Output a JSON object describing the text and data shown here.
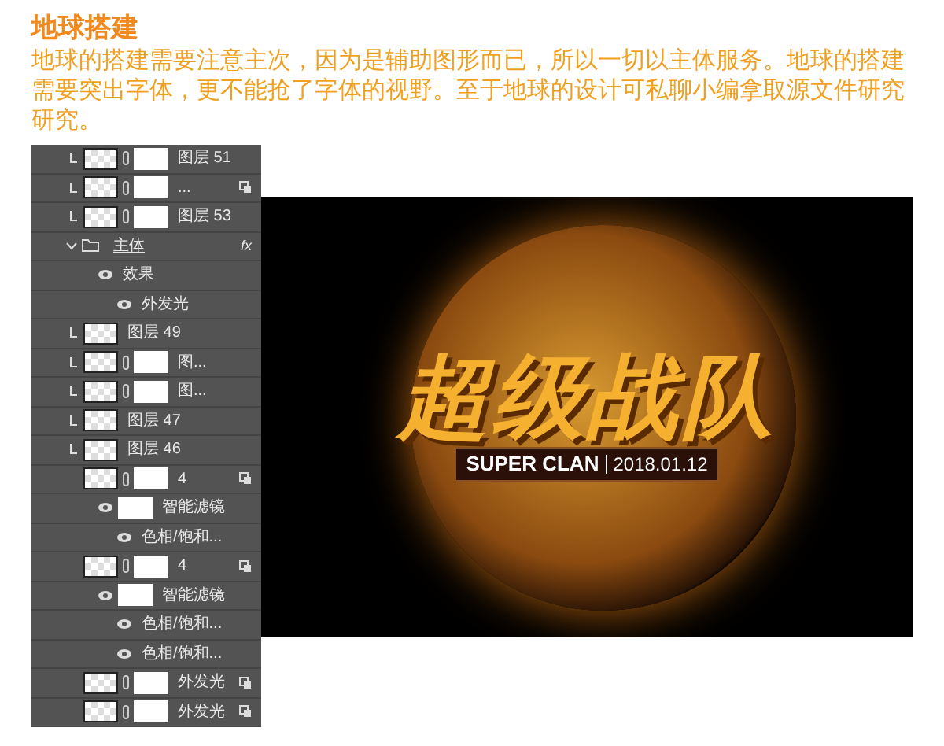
{
  "heading": "地球搭建",
  "paragraph": "地球的搭建需要注意主次，因为是辅助图形而已，所以一切以主体服务。地球的搭建需要突出字体，更不能抢了字体的视野。至于地球的设计可私聊小编拿取源文件研究研究。",
  "layers": [
    {
      "kind": "layer",
      "name": "图层 51",
      "mask": true,
      "clipped": true,
      "smart": false
    },
    {
      "kind": "layer",
      "name": "...",
      "mask": true,
      "clipped": true,
      "smart": true
    },
    {
      "kind": "layer",
      "name": "图层 53",
      "mask": true,
      "clipped": true,
      "smart": false
    },
    {
      "kind": "group",
      "name": "主体",
      "expanded": true,
      "fx": "fx",
      "children": [
        {
          "kind": "effect",
          "name": "效果",
          "children": [
            {
              "kind": "effect",
              "name": "外发光"
            }
          ]
        }
      ]
    },
    {
      "kind": "layer",
      "name": "图层 49",
      "mask": false,
      "clipped": true,
      "smart": false
    },
    {
      "kind": "layer",
      "name": "图...",
      "mask": true,
      "clipped": true,
      "smart": false
    },
    {
      "kind": "layer",
      "name": "图...",
      "mask": true,
      "clipped": true,
      "smart": false
    },
    {
      "kind": "layer",
      "name": "图层 47",
      "mask": false,
      "clipped": true,
      "smart": false
    },
    {
      "kind": "layer",
      "name": "图层 46",
      "mask": false,
      "clipped": true,
      "smart": false
    },
    {
      "kind": "layer",
      "name": "4",
      "mask": true,
      "clipped": false,
      "smart": true,
      "children": [
        {
          "kind": "filter",
          "name": "智能滤镜",
          "children": [
            {
              "kind": "effect",
              "name": "色相/饱和..."
            }
          ]
        }
      ]
    },
    {
      "kind": "layer",
      "name": "4",
      "mask": true,
      "clipped": false,
      "smart": true,
      "children": [
        {
          "kind": "filter",
          "name": "智能滤镜",
          "children": [
            {
              "kind": "effect",
              "name": "色相/饱和..."
            },
            {
              "kind": "effect",
              "name": "色相/饱和..."
            }
          ]
        }
      ]
    },
    {
      "kind": "layer",
      "name": "外发光",
      "mask": true,
      "clipped": false,
      "smart": true
    },
    {
      "kind": "layer",
      "name": "外发光",
      "mask": true,
      "clipped": false,
      "smart": true
    }
  ],
  "artwork": {
    "title": "超级战队",
    "subtitle": "SUPER CLAN",
    "date": "2018.01.12"
  }
}
